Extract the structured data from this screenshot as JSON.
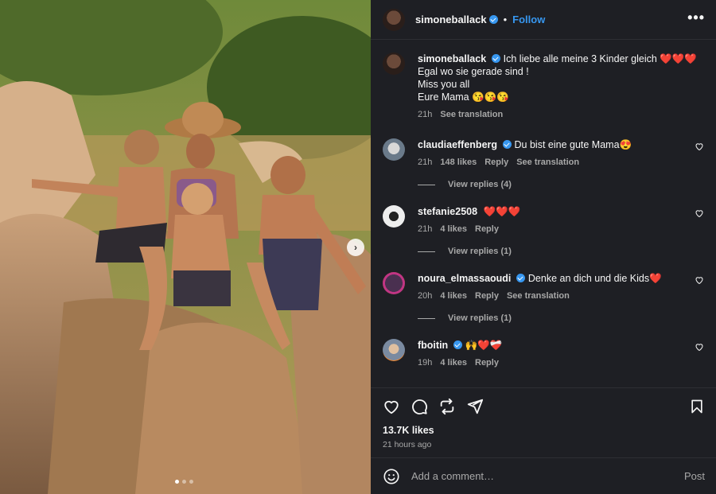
{
  "author": {
    "username": "simoneballack",
    "follow_label": "Follow",
    "separator": "•",
    "more_label": "•••"
  },
  "caption": {
    "username": "simoneballack",
    "lines": [
      "Ich liebe alle meine 3 Kinder gleich ❤️❤️❤️",
      "Egal wo sie gerade sind !",
      "Miss you all",
      "Eure Mama 😘😘😘"
    ],
    "age": "21h",
    "see_translation": "See translation"
  },
  "comments": [
    {
      "username": "claudiaeffenberg",
      "text": "Du bist eine gute Mama😍",
      "age": "21h",
      "likes": "148 likes",
      "reply": "Reply",
      "see_translation": "See translation",
      "view_replies": "View replies (4)"
    },
    {
      "username": "stefanie2508",
      "text": "❤️❤️❤️",
      "age": "21h",
      "likes": "4 likes",
      "reply": "Reply",
      "view_replies": "View replies (1)"
    },
    {
      "username": "noura_elmassaoudi",
      "text": "Denke an dich und die Kids❤️",
      "age": "20h",
      "likes": "4 likes",
      "reply": "Reply",
      "see_translation": "See translation",
      "view_replies": "View replies (1)"
    },
    {
      "username": "fboitin",
      "text": "🙌❤️❤️‍🩹",
      "age": "19h",
      "likes": "4 likes",
      "reply": "Reply"
    }
  ],
  "stats": {
    "likes": "13.7K likes",
    "time": "21 hours ago"
  },
  "composer": {
    "placeholder": "Add a comment…",
    "post_label": "Post"
  },
  "icons": [
    "heart-icon",
    "comment-icon",
    "repost-icon",
    "share-icon",
    "bookmark-icon",
    "emoji-icon",
    "verified-icon",
    "chevron-right-icon"
  ],
  "colors": {
    "accent": "#3797f0",
    "panel": "#1e1f24",
    "muted": "#a8a8a8",
    "text": "#f5f5f5"
  },
  "carousel": {
    "slides": 3,
    "active": 1
  }
}
